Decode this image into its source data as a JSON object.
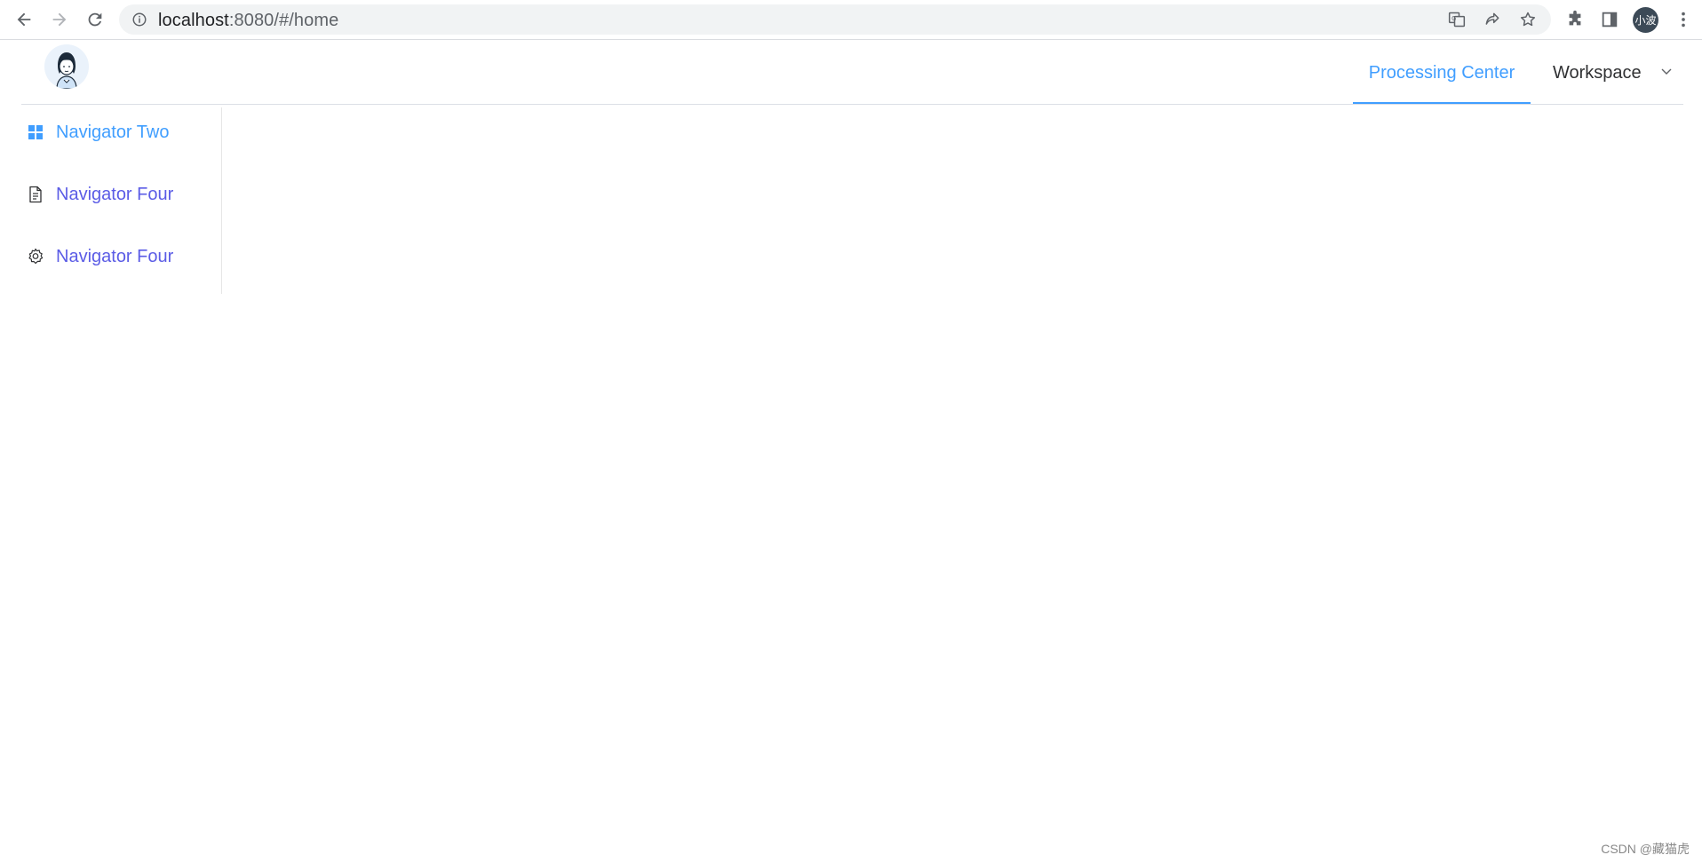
{
  "browser": {
    "url_host": "localhost",
    "url_rest": ":8080/#/home",
    "profile_label": "小波"
  },
  "header": {
    "menu": [
      {
        "label": "Processing Center",
        "active": true
      },
      {
        "label": "Workspace",
        "active": false
      }
    ]
  },
  "sidebar": {
    "items": [
      {
        "label": "Navigator Two",
        "icon": "grid-icon",
        "active": true
      },
      {
        "label": "Navigator Four",
        "icon": "document-icon",
        "active": false
      },
      {
        "label": "Navigator Four",
        "icon": "gear-icon",
        "active": false
      }
    ]
  },
  "watermark": "CSDN @藏猫虎",
  "colors": {
    "accent": "#409eff",
    "nav_link": "#5b5ce6",
    "header_border": "#dcdfe6"
  }
}
